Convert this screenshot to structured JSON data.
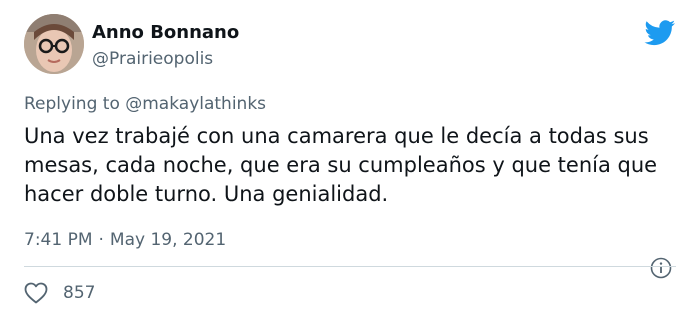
{
  "user": {
    "display_name": "Anno Bonnano",
    "handle": "@Prairieopolis",
    "avatar_icon": "profile-photo"
  },
  "reply": {
    "prefix": "Replying to",
    "mention": "@makaylathinks"
  },
  "tweet": {
    "text": "Una vez trabajé con una camarera que le decía a todas sus mesas, cada noche, que era su cumpleaños y que tenía que hacer doble turno. Una genialidad."
  },
  "meta": {
    "time": "7:41 PM",
    "separator": "·",
    "date": "May 19, 2021"
  },
  "engagement": {
    "likes": "857",
    "like_icon": "heart-icon",
    "info_icon": "info-icon"
  },
  "colors": {
    "twitter_blue": "#1d9bf0",
    "secondary_text": "#536471",
    "primary_text": "#0f1419",
    "divider": "#cfd9de"
  }
}
